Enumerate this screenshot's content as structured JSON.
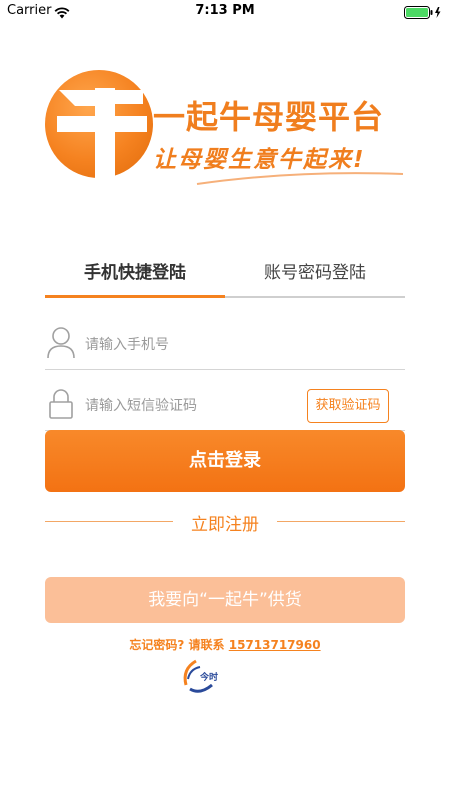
{
  "status_bar": {
    "carrier": "Carrier",
    "time": "7:13 PM",
    "icons": [
      "wifi-icon",
      "battery-icon",
      "charging-bolt-icon"
    ]
  },
  "brand": {
    "logo_glyph": "牛",
    "title": "一起牛母婴平台",
    "slogan": "让母婴生意牛起来!",
    "accent_color": "#f5821f"
  },
  "tabs": [
    {
      "label": "手机快捷登陆",
      "active": true
    },
    {
      "label": "账号密码登陆",
      "active": false
    }
  ],
  "form": {
    "phone_placeholder": "请输入手机号",
    "phone_value": "",
    "code_placeholder": "请输入短信验证码",
    "code_value": "",
    "get_code_label": "获取验证码"
  },
  "actions": {
    "login_label": "点击登录",
    "register_label": "立即注册",
    "supply_label": "我要向“一起牛”供货"
  },
  "footer": {
    "forgot_text": "忘记密码? 请联系 ",
    "contact_phone": "15713717960",
    "logo_text": "今时"
  }
}
